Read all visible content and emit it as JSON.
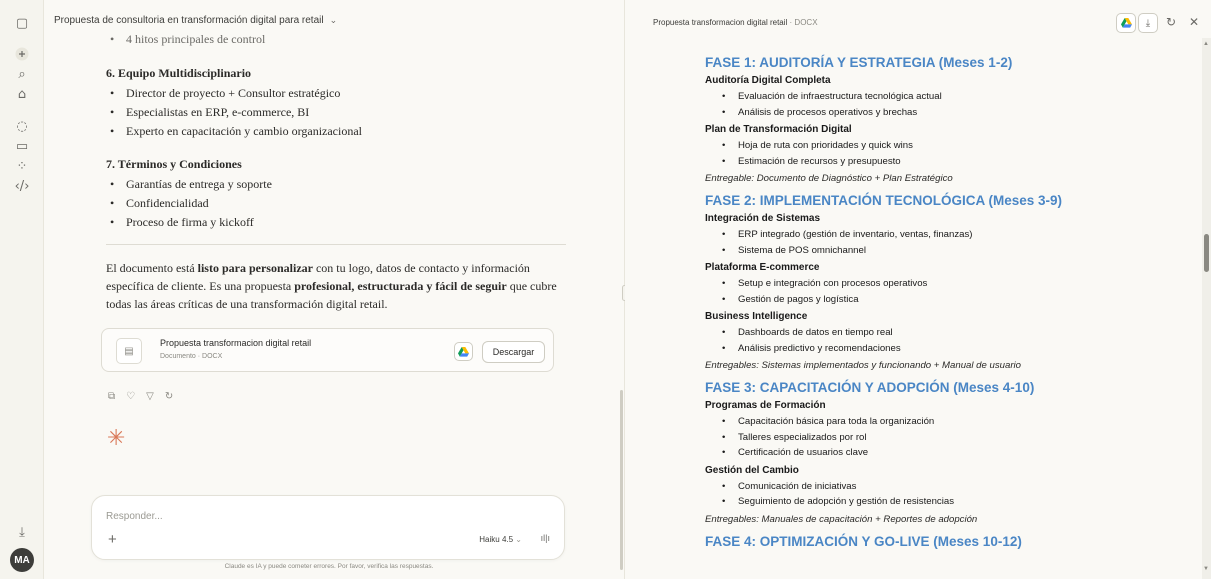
{
  "chat": {
    "title": "Propuesta de consultoria en transformación digital para retail",
    "top_bullet": "4 hitos principales de control",
    "section6": {
      "heading": "6. Equipo Multidisciplinario",
      "items": [
        "Director de proyecto + Consultor estratégico",
        "Especialistas en ERP, e-commerce, BI",
        "Experto en capacitación y cambio organizacional"
      ]
    },
    "section7": {
      "heading": "7. Términos y Condiciones",
      "items": [
        "Garantías de entrega y soporte",
        "Confidencialidad",
        "Proceso de firma y kickoff"
      ]
    },
    "closing": {
      "t1": "El documento está ",
      "b1": "listo para personalizar",
      "t2": " con tu logo, datos de contacto y información específica de cliente. Es una propuesta ",
      "b2": "profesional, estructurada y fácil de seguir",
      "t3": " que cubre todas las áreas críticas de una transformación digital retail."
    },
    "file_card": {
      "title": "Propuesta transformacion digital retail",
      "subtitle": "Documento · DOCX",
      "download_label": "Descargar"
    },
    "composer": {
      "placeholder": "Responder...",
      "model": "Haiku 4.5"
    },
    "disclaimer": "Claude es IA y puede cometer errores. Por favor, verifica las respuestas."
  },
  "user": {
    "initials": "MA"
  },
  "panel": {
    "title": "Propuesta transformacion digital retail",
    "subtitle": "· DOCX"
  },
  "document": {
    "fase1": {
      "title": "FASE 1: AUDITORÍA Y ESTRATEGIA (Meses 1-2)",
      "g1": {
        "heading": "Auditoría Digital Completa",
        "items": [
          "Evaluación de infraestructura tecnológica actual",
          "Análisis de procesos operativos y brechas"
        ]
      },
      "g2": {
        "heading": "Plan de Transformación Digital",
        "items": [
          "Hoja de ruta con prioridades y quick wins",
          "Estimación de recursos y presupuesto"
        ]
      },
      "deliverable": "Entregable: Documento de Diagnóstico + Plan Estratégico"
    },
    "fase2": {
      "title": "FASE 2: IMPLEMENTACIÓN TECNOLÓGICA (Meses 3-9)",
      "g1": {
        "heading": "Integración de Sistemas",
        "items": [
          "ERP integrado (gestión de inventario, ventas, finanzas)",
          "Sistema de POS omnichannel"
        ]
      },
      "g2": {
        "heading": "Plataforma E-commerce",
        "items": [
          "Setup e integración con procesos operativos",
          "Gestión de pagos y logística"
        ]
      },
      "g3": {
        "heading": "Business Intelligence",
        "items": [
          "Dashboards de datos en tiempo real",
          "Análisis predictivo y recomendaciones"
        ]
      },
      "deliverable": "Entregables: Sistemas implementados y funcionando + Manual de usuario"
    },
    "fase3": {
      "title": "FASE 3: CAPACITACIÓN Y ADOPCIÓN (Meses 4-10)",
      "g1": {
        "heading": "Programas de Formación",
        "items": [
          "Capacitación básica para toda la organización",
          "Talleres especializados por rol",
          "Certificación de usuarios clave"
        ]
      },
      "g2": {
        "heading": "Gestión del Cambio",
        "items": [
          "Comunicación de iniciativas",
          "Seguimiento de adopción y gestión de resistencias"
        ]
      },
      "deliverable": "Entregables: Manuales de capacitación + Reportes de adopción"
    },
    "fase4": {
      "title": "FASE 4: OPTIMIZACIÓN Y GO-LIVE (Meses 10-12)"
    }
  },
  "colors": {
    "phase_heading": "#4a86c5",
    "accent": "#d97757"
  },
  "icons": [
    "sidebar-toggle-icon",
    "new-chat-icon",
    "search-icon",
    "projects-icon",
    "chats-icon",
    "artifacts-icon",
    "apps-icon",
    "code-icon",
    "download-icon",
    "google-drive-icon",
    "copy-icon",
    "thumbs-up-icon",
    "thumbs-down-icon",
    "retry-icon",
    "close-icon"
  ]
}
